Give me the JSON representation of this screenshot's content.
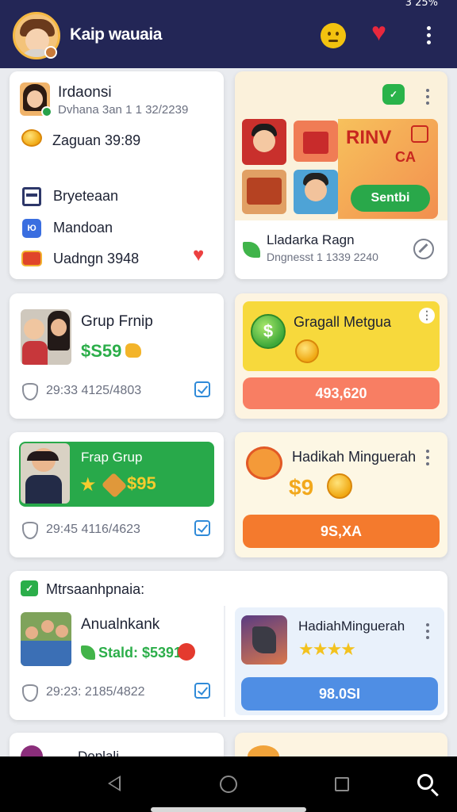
{
  "status_bar": {
    "battery_text": "3 25%"
  },
  "header": {
    "title": "Kaip wauaia",
    "icons": [
      "avatar",
      "emoji-face-icon",
      "heart-icon",
      "more-vertical-icon"
    ],
    "accent_color": "#232656"
  },
  "profile_card": {
    "name": "Irdaonsi",
    "subtitle": "Dvhana 3an 1 1 32/2239",
    "coin_label": "Zaguan 39:89",
    "menu": [
      {
        "label": "Bryeteaan",
        "icon": "card-icon"
      },
      {
        "label": "Mandoan",
        "icon": "app-icon"
      },
      {
        "label": "Uadngn 3948",
        "icon": "gift-icon"
      }
    ]
  },
  "promo_card": {
    "badge_icon": "chat-badge-icon",
    "banner_text": "RINV",
    "banner_subtext": "CA",
    "button_label": "Sentbi",
    "title": "Lladarka Ragn",
    "subtitle": "Dngnesst 1 1339 2240"
  },
  "group_card_1": {
    "title": "Grup Frnip",
    "amount": "$S59",
    "stats": "29:33 4125/4803"
  },
  "reward_card_1": {
    "title": "Gragall Metgua",
    "button_label": "493,620",
    "colors": {
      "panel": "#f7d93c",
      "button": "#f87e63"
    }
  },
  "group_card_2": {
    "title": "Frap Grup",
    "amount": "$95",
    "stats": "29:45 4116/4623",
    "colors": {
      "panel": "#28a94a"
    }
  },
  "reward_card_2": {
    "title": "Hadikah Minguerah",
    "amount": "$9",
    "button_label": "9S,XA",
    "colors": {
      "button": "#f47a2d"
    }
  },
  "section_card": {
    "header": "Mtrsaanhpnaia:",
    "item_title": "Anualnkank",
    "item_line": "Stald: $5391",
    "stats": "29:23: 2185/4822",
    "side_title": "HadiahMinguerah",
    "rating": 4,
    "side_button_label": "98.0SI",
    "colors": {
      "side_button": "#4f8ee4"
    }
  },
  "next_card": {
    "title": "Doplali"
  },
  "nav": {
    "icons": [
      "back-icon",
      "home-icon",
      "recents-icon",
      "search-icon"
    ]
  }
}
